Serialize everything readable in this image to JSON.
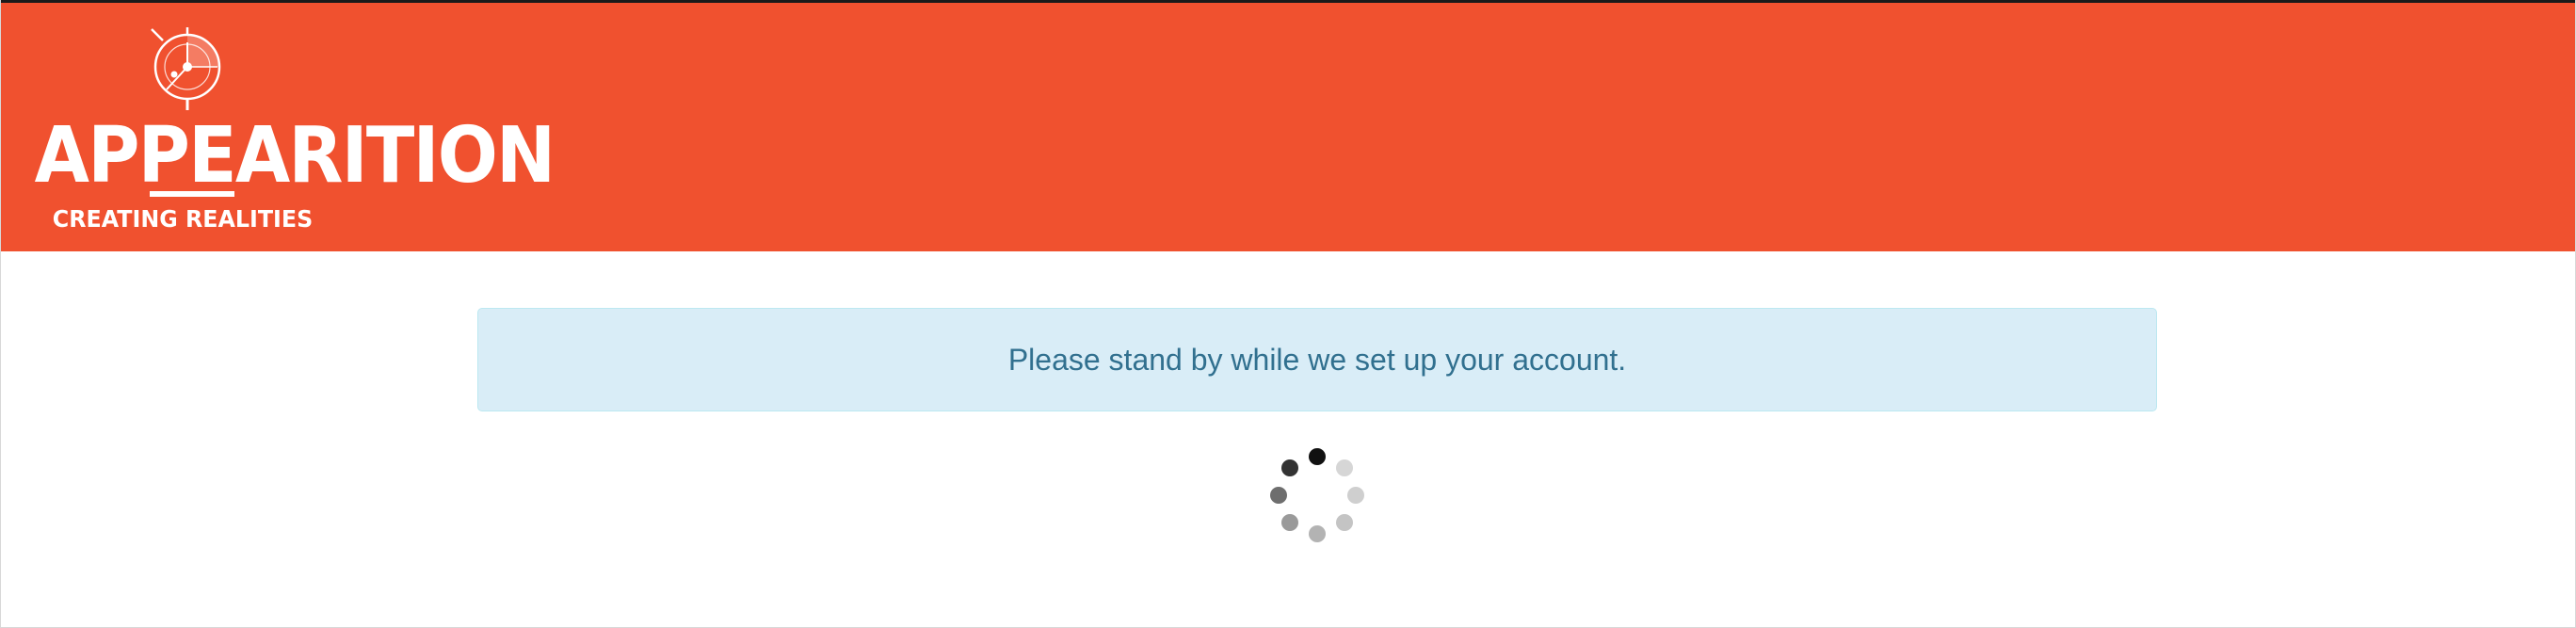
{
  "brand": {
    "name": "APPEARITION",
    "tagline": "CREATING REALITIES",
    "header_color": "#f0512f",
    "logo_icon": "compass-reticle-icon"
  },
  "status": {
    "message": "Please stand by while we set up your account.",
    "alert_background": "#d9edf7",
    "alert_border": "#bce8f1",
    "alert_text_color": "#31708f"
  },
  "loading": {
    "icon": "loading-spinner-icon",
    "dot_colors": [
      "#111111",
      "#d6d6d6",
      "#cfcfcf",
      "#c4c4c4",
      "#b3b3b3",
      "#9a9a9a",
      "#6e6e6e",
      "#333333"
    ]
  }
}
